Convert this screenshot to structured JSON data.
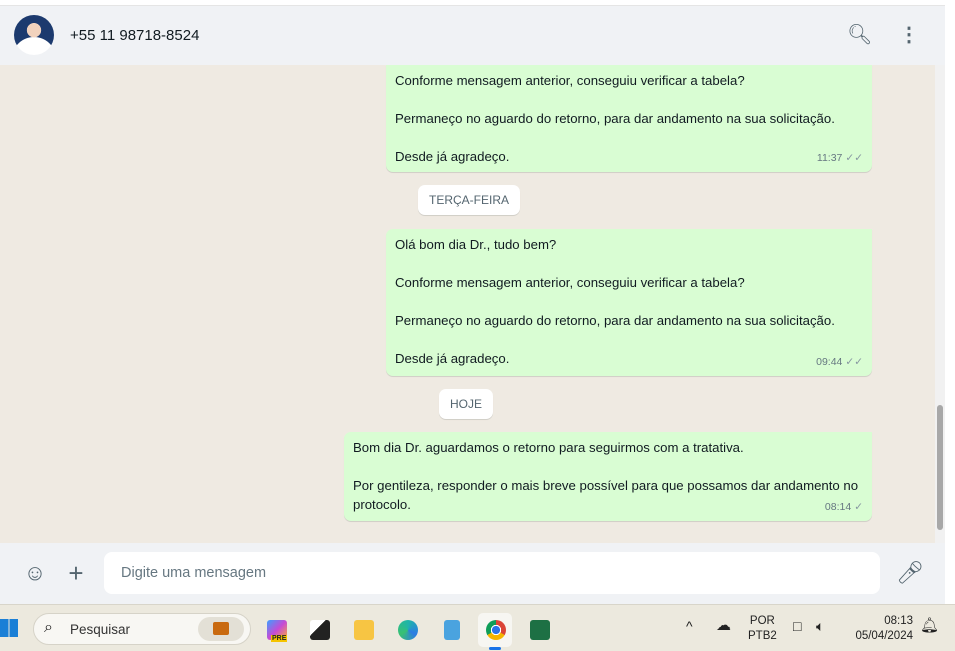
{
  "header": {
    "contact": "+55 11 98718-8524",
    "search_icon": "search-icon",
    "menu_icon": "kebab-menu-icon"
  },
  "messages": [
    {
      "text": "Conforme mensagem anterior, conseguiu verificar a tabela?\n\nPermaneço no aguardo do retorno, para dar andamento na sua solicitação.\n\nDesde já agradeço.",
      "time": "11:37",
      "status": "✓✓"
    },
    {
      "date": "TERÇA-FEIRA"
    },
    {
      "text": "Olá bom dia Dr., tudo bem?\n\nConforme mensagem anterior, conseguiu verificar a tabela?\n\nPermaneço no aguardo do retorno, para dar andamento na sua solicitação.\n\nDesde já agradeço.",
      "time": "09:44",
      "status": "✓✓"
    },
    {
      "date": "HOJE"
    },
    {
      "text": "Bom dia Dr. aguardamos o retorno para seguirmos com a tratativa.\n\nPor gentileza, responder o mais breve possível para que possamos dar andamento no protocolo.",
      "time": "08:14",
      "status": "✓"
    }
  ],
  "footer": {
    "placeholder": "Digite uma mensagem"
  },
  "taskbar": {
    "search_label": "Pesquisar",
    "lang_top": "POR",
    "lang_bottom": "PTB2",
    "time": "08:13",
    "date": "05/04/2024",
    "copilot_badge": "PRE"
  }
}
